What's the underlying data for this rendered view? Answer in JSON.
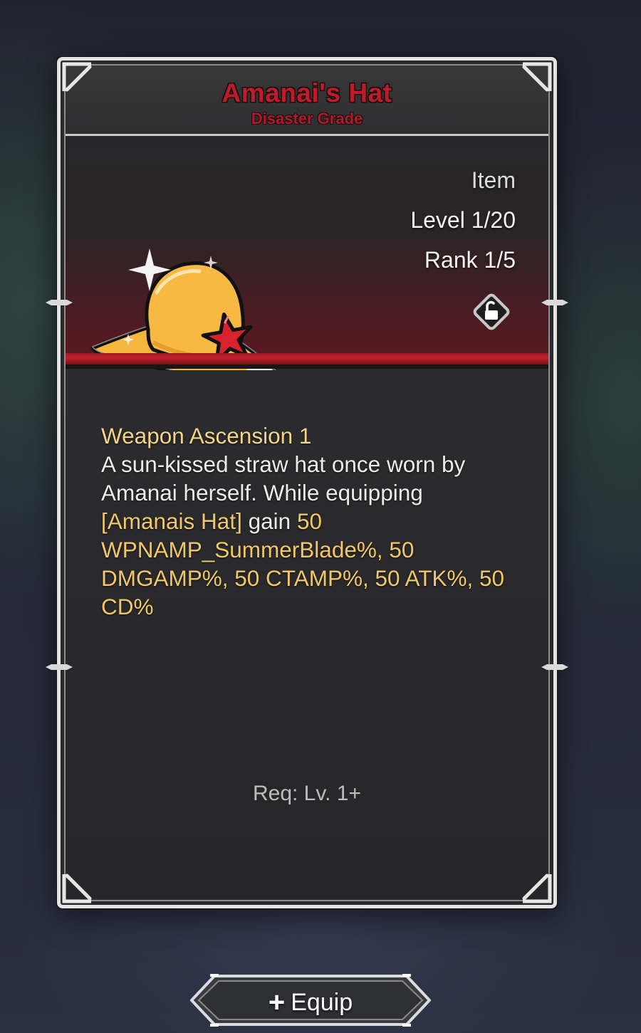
{
  "item": {
    "name": "Amanai's Hat",
    "grade": "Disaster Grade",
    "type": "Item",
    "level": "Level 1/20",
    "rank": "Rank 1/5",
    "lock_state": "unlocked",
    "icon": "straw-hat-icon"
  },
  "description": {
    "title": "Weapon Ascension 1",
    "text": "A sun-kissed straw hat once worn by Amanai herself. While equipping",
    "highlight_item": "[Amanais Hat]",
    "connector": "gain",
    "bonuses": "50 WPNAMP_SummerBlade%, 50 DMGAMP%, 50 CTAMP%, 50 ATK%, 50 CD%"
  },
  "requirement": "Req: Lv. 1+",
  "equip_button": {
    "icon": "plus-icon",
    "label": "Equip"
  },
  "colors": {
    "name_red": "#c01b2b",
    "gold_text": "#f0c869",
    "hat_yellow": "#f5b63c",
    "star_red": "#d8222e"
  }
}
